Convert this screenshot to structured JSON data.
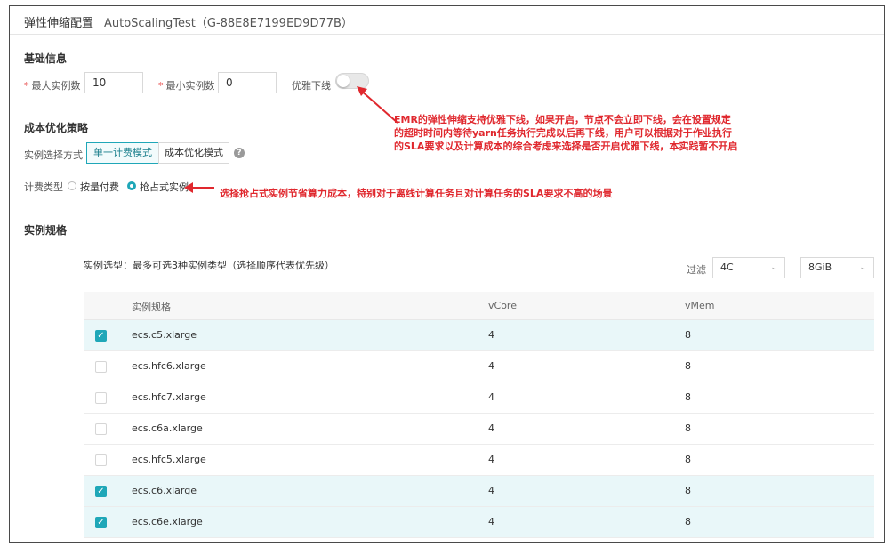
{
  "header": {
    "title": "弹性伸缩配置",
    "subtitle": "AutoScalingTest（G-88E8E7199ED9D77B）"
  },
  "basic": {
    "title": "基础信息",
    "max_label": "最大实例数",
    "max_value": "10",
    "min_label": "最小实例数",
    "min_value": "0",
    "graceful_label": "优雅下线",
    "graceful_enabled": false,
    "required_mark": "*"
  },
  "cost": {
    "title": "成本优化策略",
    "mode_label": "实例选择方式",
    "modes": [
      "单一计费模式",
      "成本优化模式"
    ],
    "selected_mode": "单一计费模式",
    "help_glyph": "?",
    "billing_label": "计费类型",
    "billing_options": [
      "按量付费",
      "抢占式实例"
    ],
    "selected_billing": "抢占式实例"
  },
  "annotations": {
    "graceful_note_lines": [
      "EMR的弹性伸缩支持优雅下线，如果开启，节点不会立即下线，会在设置规定",
      "的超时时间内等待yarn任务执行完成以后再下线，用户可以根据对于作业执行",
      "的SLA要求以及计算成本的综合考虑来选择是否开启优雅下线，本实践暂不开启"
    ],
    "spot_note": "选择抢占式实例节省算力成本，特别对于离线计算任务且对计算任务的SLA要求不高的场景"
  },
  "spec": {
    "title": "实例规格",
    "note": "实例选型：最多可选3种实例类型（选择顺序代表优先级）",
    "filter_label": "过滤",
    "filter_cpu": "4C",
    "filter_mem": "8GiB",
    "columns": [
      "实例规格",
      "vCore",
      "vMem"
    ],
    "rows": [
      {
        "name": "ecs.c5.xlarge",
        "vcore": "4",
        "vmem": "8",
        "checked": true
      },
      {
        "name": "ecs.hfc6.xlarge",
        "vcore": "4",
        "vmem": "8",
        "checked": false
      },
      {
        "name": "ecs.hfc7.xlarge",
        "vcore": "4",
        "vmem": "8",
        "checked": false
      },
      {
        "name": "ecs.c6a.xlarge",
        "vcore": "4",
        "vmem": "8",
        "checked": false
      },
      {
        "name": "ecs.hfc5.xlarge",
        "vcore": "4",
        "vmem": "8",
        "checked": false
      },
      {
        "name": "ecs.c6.xlarge",
        "vcore": "4",
        "vmem": "8",
        "checked": true
      },
      {
        "name": "ecs.c6e.xlarge",
        "vcore": "4",
        "vmem": "8",
        "checked": true
      }
    ]
  },
  "colors": {
    "accent": "#1fa7b8",
    "annotation": "#e0282e",
    "selected_row": "#e9f7f9"
  }
}
